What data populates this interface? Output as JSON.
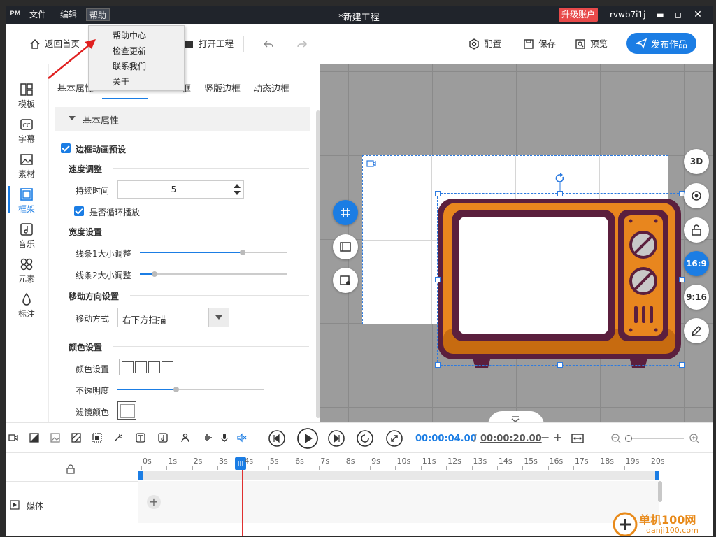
{
  "app": {
    "logo": "PM",
    "title": "*新建工程",
    "upgrade_label": "升级账户",
    "username": "rvwb7i1j"
  },
  "menubar": [
    "文件",
    "编辑",
    "帮助"
  ],
  "help_menu": [
    "帮助中心",
    "检查更新",
    "联系我们",
    "关于"
  ],
  "toolbar": {
    "back_home": "返回首页",
    "open_project": "打开工程",
    "config": "配置",
    "save": "保存",
    "preview": "预览",
    "publish": "发布作品"
  },
  "sidebar": [
    "模板",
    "字幕",
    "素材",
    "框架",
    "音乐",
    "元素",
    "标注"
  ],
  "panel": {
    "tabs": [
      "基本属性",
      "框",
      "竖版边框",
      "动态边框"
    ],
    "section_title": "基本属性",
    "border_anim_preset": "边框动画预设",
    "speed_heading": "速度调整",
    "duration_label": "持续时间",
    "duration_value": "5",
    "loop_label": "是否循环播放",
    "width_heading": "宽度设置",
    "line1_label": "线条1大小调整",
    "line1_value": 0.7,
    "line2_label": "线条2大小调整",
    "line2_value": 0.1,
    "direction_heading": "移动方向设置",
    "move_mode_label": "移动方式",
    "move_mode_value": "右下方扫描",
    "color_heading": "颜色设置",
    "color_label": "颜色设置",
    "opacity_label": "不透明度",
    "opacity_value": 0.4,
    "filter_color_label": "滤镜颜色"
  },
  "canvas": {
    "ratio_16_9": "16:9",
    "ratio_9_16": "9:16",
    "btn_3d": "3D"
  },
  "timeline": {
    "current_time": "00:00:04.00",
    "separator": "/",
    "total_time": "00:00:20.00",
    "ruler_labels": [
      "0s",
      "1s",
      "2s",
      "3s",
      "4s",
      "5s",
      "6s",
      "7s",
      "8s",
      "9s",
      "10s",
      "11s",
      "12s",
      "13s",
      "14s",
      "15s",
      "16s",
      "17s",
      "18s",
      "19s",
      "20s"
    ],
    "track_label": "媒体"
  },
  "watermark": {
    "text": "单机100网",
    "url": "danji100.com"
  },
  "colors": {
    "accent": "#1b7de4",
    "upgrade": "#e84a4a",
    "titlebar": "#20242b"
  }
}
